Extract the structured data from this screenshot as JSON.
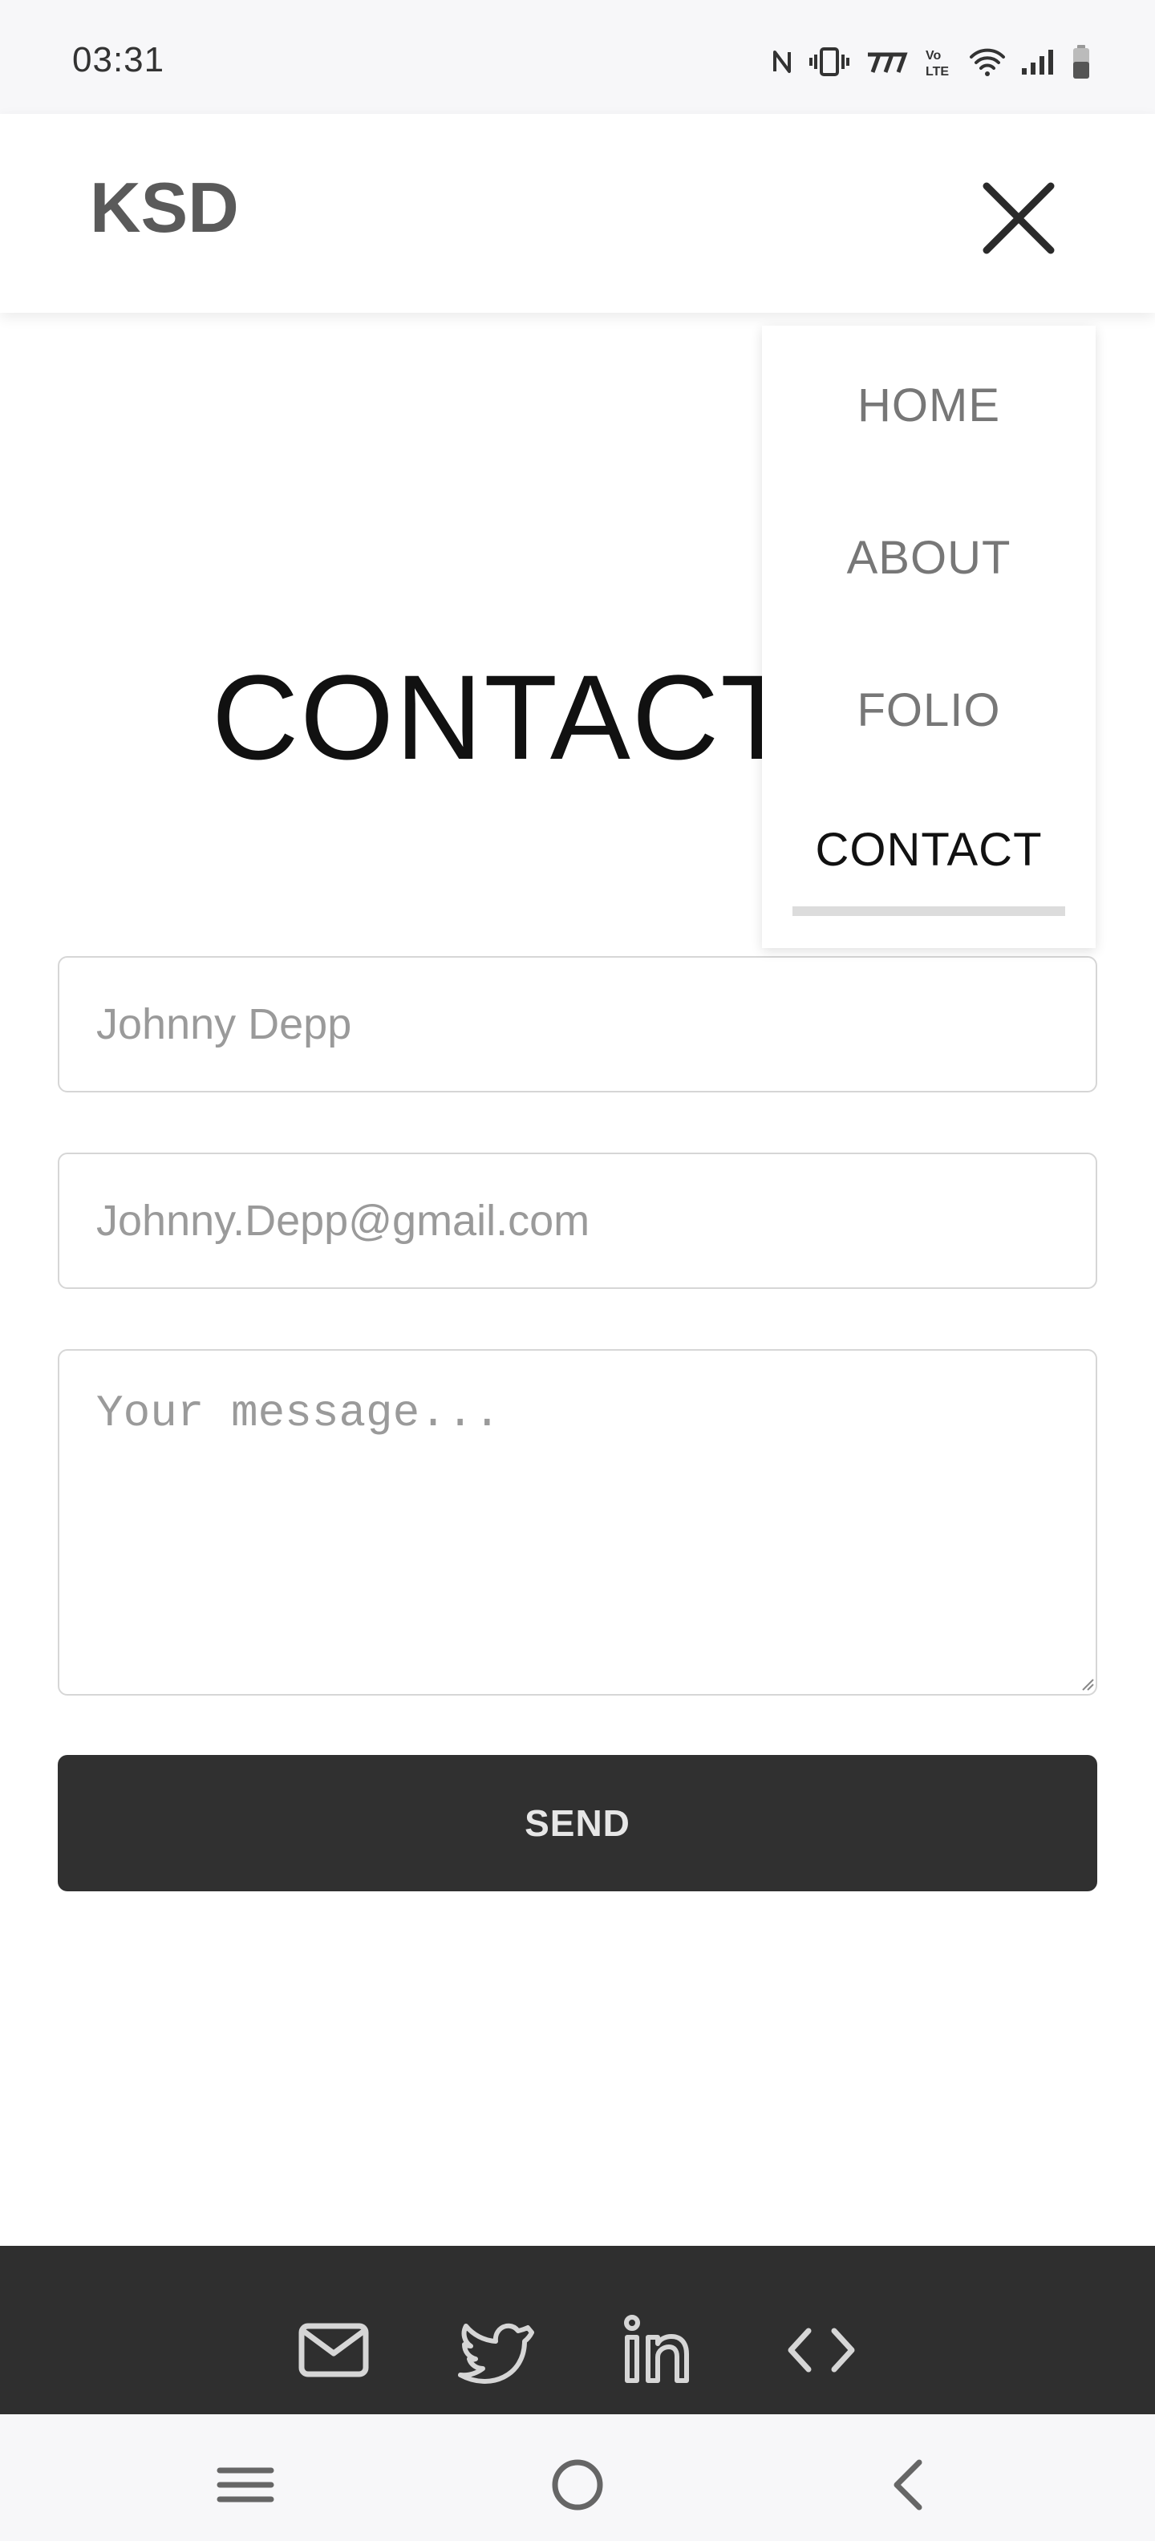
{
  "status_bar": {
    "time": "03:31",
    "icons": [
      "nfc-icon",
      "vibrate-icon",
      "signal-carrier-icon",
      "volte-icon",
      "wifi-icon",
      "cell-signal-icon",
      "battery-icon"
    ]
  },
  "header": {
    "brand": "KSD",
    "close_icon": "close-icon"
  },
  "nav": {
    "items": [
      {
        "label": "HOME",
        "active": false
      },
      {
        "label": "ABOUT",
        "active": false
      },
      {
        "label": "FOLIO",
        "active": false
      },
      {
        "label": "CONTACT",
        "active": true
      }
    ]
  },
  "page": {
    "title": "CONTACT"
  },
  "form": {
    "name_placeholder": "Johnny Depp",
    "email_placeholder": "Johnny.Depp@gmail.com",
    "message_placeholder": "Your message...",
    "send_label": "SEND"
  },
  "footer": {
    "icons": [
      "mail-icon",
      "twitter-icon",
      "linkedin-icon",
      "code-icon"
    ]
  },
  "system_nav": {
    "buttons": [
      "menu-icon",
      "home-icon",
      "back-icon"
    ]
  },
  "colors": {
    "header_bg": "#ffffff",
    "footer_bg": "#2f2f2f",
    "button_bg": "#303030",
    "brand_text": "#5a5a5a",
    "muted_text": "#777777",
    "active_text": "#111111"
  }
}
